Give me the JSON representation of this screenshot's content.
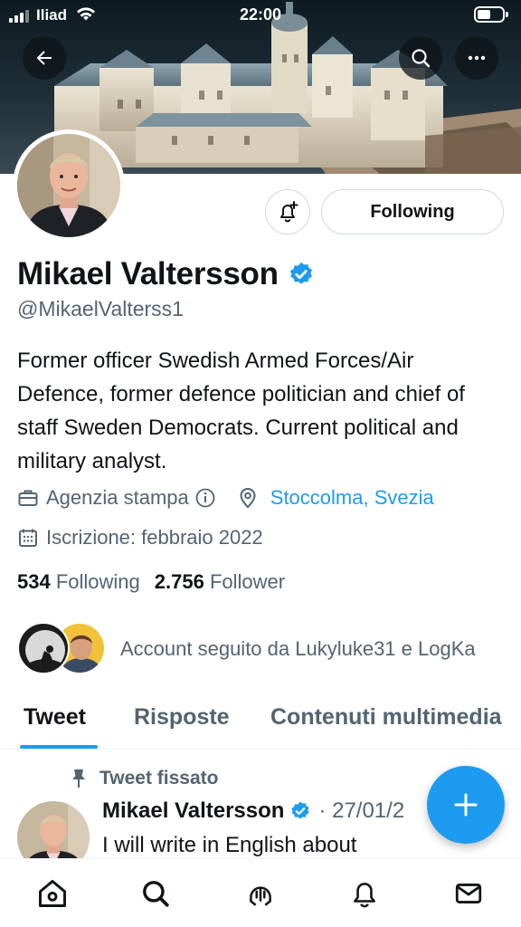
{
  "status_bar": {
    "carrier": "Iliad",
    "time": "22:00",
    "battery_level": 0.55
  },
  "header": {
    "back_icon": "arrow-left-icon",
    "search_icon": "search-icon",
    "more_icon": "more-horizontal-icon"
  },
  "profile": {
    "name": "Mikael Valtersson",
    "handle": "@MikaelValterss1",
    "verified": true,
    "bio": "Former officer Swedish Armed Forces/Air Defence, former defence politician and chief of staff Sweden Democrats. Current political and military analyst.",
    "category": "Agenzia stampa",
    "location": "Stoccolma, Svezia",
    "joined": "Iscrizione: febbraio 2022",
    "following_count": "534",
    "following_label": "Following",
    "followers_count": "2.756",
    "followers_label": "Follower",
    "followed_by": "Account seguito da Lukyluke31 e LogKa"
  },
  "actions": {
    "following_button": "Following"
  },
  "tabs": [
    {
      "label": "Tweet",
      "active": true
    },
    {
      "label": "Risposte",
      "active": false
    },
    {
      "label": "Contenuti multimedia",
      "active": false
    }
  ],
  "pinned_tweet": {
    "pinned_label": "Tweet fissato",
    "author": "Mikael Valtersson",
    "date": "· 27/01/2",
    "text": "I will write in English about"
  },
  "colors": {
    "accent": "#1d9bf0",
    "text": "#0f1419",
    "secondary": "#536471"
  },
  "bottom_nav": [
    "home-icon",
    "search-icon",
    "spaces-icon",
    "notifications-icon",
    "messages-icon"
  ]
}
